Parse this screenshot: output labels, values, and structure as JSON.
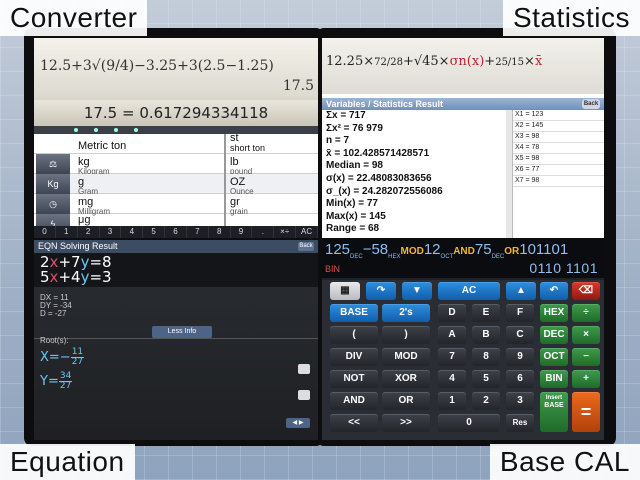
{
  "labels": {
    "converter": "Converter",
    "statistics": "Statistics",
    "equation": "Equation",
    "base_cal": "Base CAL"
  },
  "converter": {
    "expression": "12.5+3√(9/4)−3.25+3(2.5−1.25)",
    "previous_value": "17.5",
    "result": "17.5 = 0.617294334118",
    "rows": [
      {
        "icon": "",
        "left": "Metric ton",
        "left_sub": "",
        "right": "st",
        "right_sub": ""
      },
      {
        "icon": "",
        "left": "kg",
        "left_sub": "Kilogram",
        "right": "lb",
        "right_sub": "pound"
      },
      {
        "icon": "Kg",
        "left": "g",
        "left_sub": "Gram",
        "right": "OZ",
        "right_sub": "Ounce"
      },
      {
        "icon": "",
        "left": "mg",
        "left_sub": "Milligram",
        "right": "gr",
        "right_sub": "grain"
      },
      {
        "icon": "",
        "left": "μg",
        "left_sub": "",
        "right": "",
        "right_sub": ""
      }
    ],
    "right_top": "short ton",
    "keypad": [
      "0",
      "1",
      "2",
      "3",
      "4",
      "5",
      "6",
      "7",
      "8",
      "9",
      ".",
      "×÷",
      "AC"
    ]
  },
  "statistics": {
    "expression_parts": [
      "12.25×",
      "72/28",
      "+√45×",
      "σn(x)",
      "+",
      "25/15",
      "×",
      "x̄"
    ],
    "title": "Variables / Statistics Result",
    "back_label": "Back",
    "items": [
      "Σx = 717",
      "Σx² = 76 979",
      "n = 7",
      "x̄ = 102.428571428571",
      "Median = 98",
      "σ(x) = 22.48083083656",
      "σ_(x) = 24.282072556086",
      "Min(x) = 77",
      "Max(x) = 145",
      "Range = 68"
    ],
    "values": [
      "X1 = 123",
      "X2 = 145",
      "X3 = 98",
      "X4 = 78",
      "X5 = 98",
      "X6 = 77",
      "X7 = 98"
    ]
  },
  "equation": {
    "title": "EQN Solving Result",
    "back_label": "Back",
    "eq1": {
      "a": "2",
      "b": "+7",
      "c": "=8"
    },
    "eq2": {
      "a": "5",
      "b": "+4",
      "c": "=3"
    },
    "dets": [
      "DX = 11",
      "DY = -34",
      "D   = -27"
    ],
    "less_info": "Less Info",
    "roots_label": "Root(s):",
    "x_root": {
      "prefix": "X=−",
      "num": "11",
      "den": "27"
    },
    "y_root": {
      "prefix": "Y=",
      "num": "34",
      "den": "27"
    },
    "page_btn": "◀ ▶"
  },
  "base": {
    "expr": {
      "n1": "125",
      "b1": "DEC",
      "n2": "−58",
      "b2": "HEX",
      "op1": "MOD",
      "n3": "12",
      "b3": "OCT",
      "op2": "AND",
      "n4": "75",
      "b4": "DEC",
      "op3": "OR",
      "n5": "101101"
    },
    "mode": "BIN",
    "result": "0110 1101",
    "keys": {
      "grid": "▦",
      "redo": "↷",
      "down": "▼",
      "ac": "AC",
      "up": "▲",
      "undo": "↶",
      "del": "⌫",
      "base": "BASE",
      "twos": "2's",
      "d": "D",
      "e": "E",
      "f": "F",
      "hex": "HEX",
      "div_sym": "÷",
      "lparen": "(",
      "rparen": ")",
      "a": "A",
      "b": "B",
      "c": "C",
      "dec": "DEC",
      "mul_sym": "×",
      "div": "DIV",
      "mod": "MOD",
      "seven": "7",
      "eight": "8",
      "nine": "9",
      "oct": "OCT",
      "minus": "−",
      "not": "NOT",
      "xor": "XOR",
      "four": "4",
      "five": "5",
      "six": "6",
      "bin": "BIN",
      "plus": "+",
      "and": "AND",
      "or": "OR",
      "one": "1",
      "two": "2",
      "three": "3",
      "insert": "Insert",
      "insert_base": "BASE",
      "equals": "=",
      "shl": "<<",
      "shr": ">>",
      "zero": "0",
      "res": "Res"
    }
  },
  "colors": {
    "red_var": "#c0262e",
    "blue_var": "#6cc6f5",
    "pink_var": "#e14b6b",
    "key_blue": "#2d8fe0",
    "key_green": "#3f9b4b",
    "key_orange": "#ec6a1c"
  }
}
